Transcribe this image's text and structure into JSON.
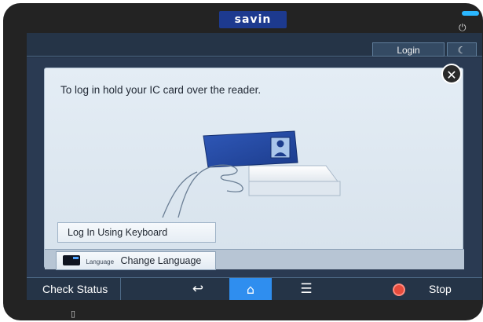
{
  "device": {
    "brand": "savin"
  },
  "topbar": {
    "login_label": "Login",
    "night_icon": "crescent-moon-icon"
  },
  "dialog": {
    "message": "To log in hold your IC card over the reader.",
    "close_icon": "close-icon",
    "keyboard_login_label": "Log In Using Keyboard",
    "language_small_label": "Language",
    "change_language_label": "Change Language"
  },
  "bottombar": {
    "check_status_label": "Check Status",
    "back_icon": "back-arrow-icon",
    "home_icon": "home-icon",
    "menu_icon": "menu-icon",
    "stop_icon": "stop-icon",
    "stop_label": "Stop"
  },
  "colors": {
    "bezel": "#232323",
    "screen": "#1f2b3d",
    "accent": "#2f8eef",
    "stop": "#e74b3c",
    "brand": "#1d3a8f"
  }
}
